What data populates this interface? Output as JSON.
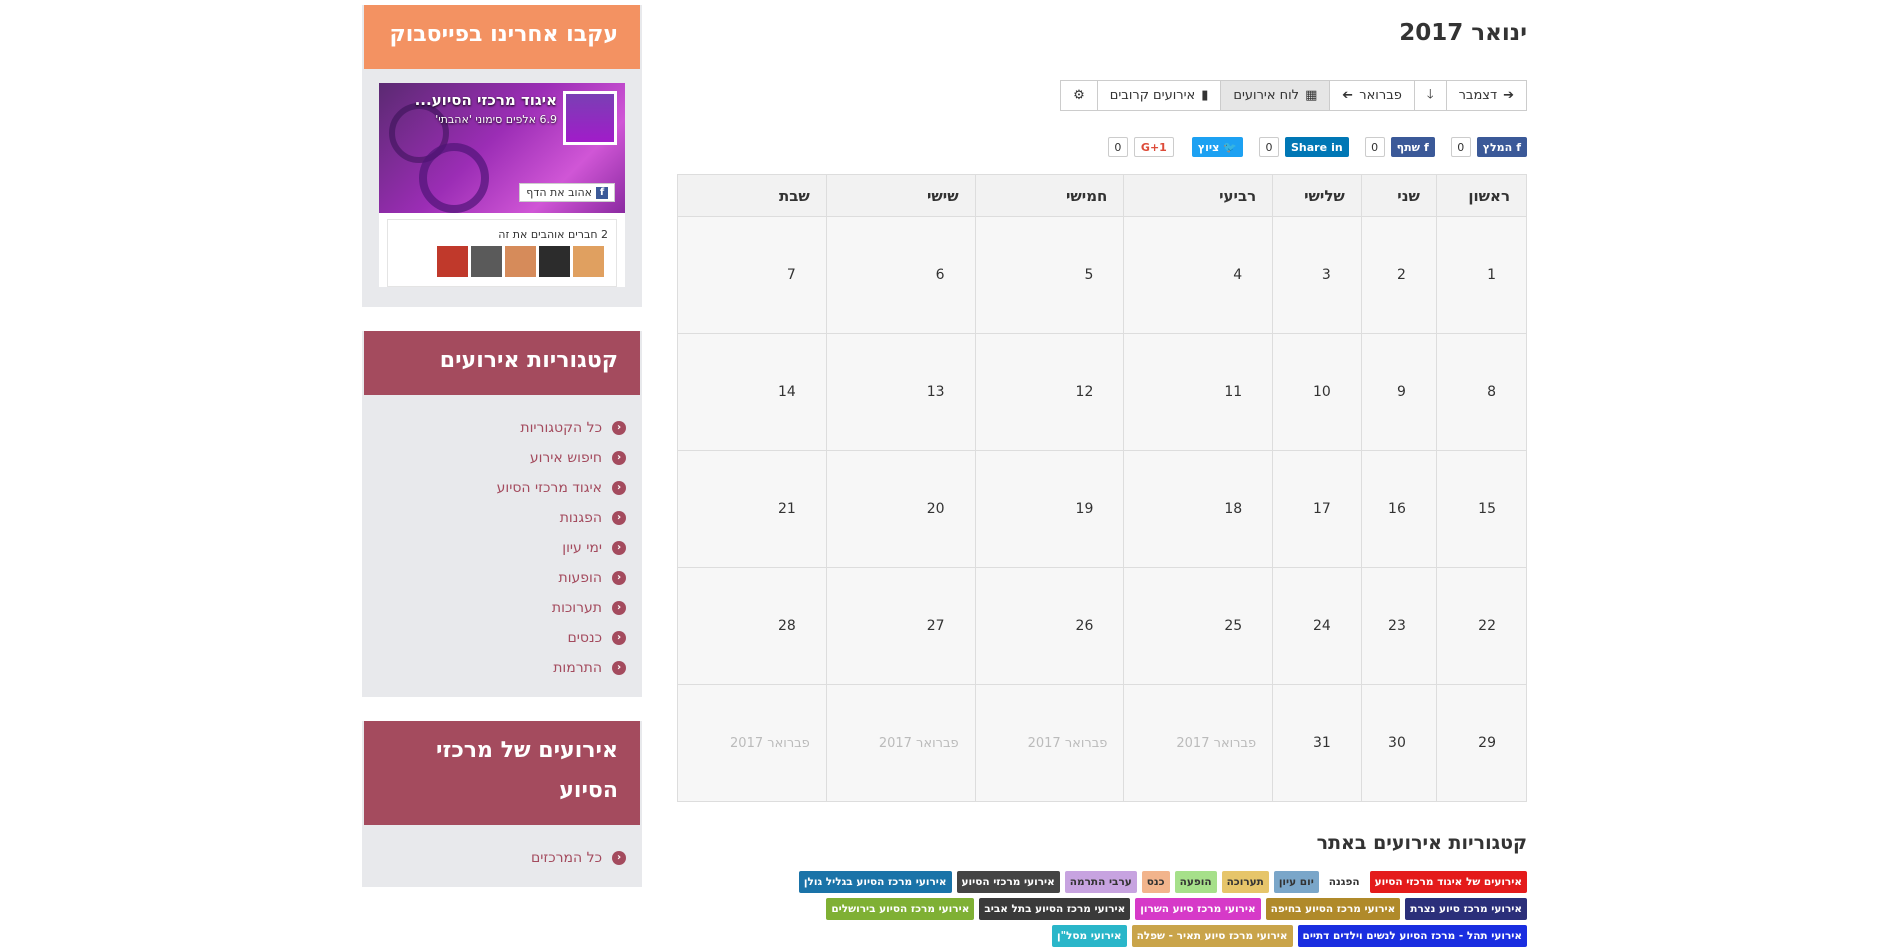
{
  "sidebar": {
    "facebook_widget": {
      "title": "עקבו אחרינו בפייסבוק",
      "page_name": "איגוד מרכזי הסיוע...",
      "likes_text": "6.9 אלפים סימוני 'אהבתי'",
      "like_button": "אהוב את הדף",
      "friends_text": "2 חברים אוהבים את זה",
      "face_colors": [
        "#c0392b",
        "#5a5a5a",
        "#d68b5a",
        "#2c2c2c",
        "#e0a060"
      ]
    },
    "categories_widget": {
      "title": "קטגוריות אירועים",
      "items": [
        {
          "label": "כל הקטגוריות"
        },
        {
          "label": "חיפוש אירוע"
        },
        {
          "label": "איגוד מרכזי הסיוע"
        },
        {
          "label": "הפגנות"
        },
        {
          "label": "ימי עיון"
        },
        {
          "label": "הופעות"
        },
        {
          "label": "תערוכות"
        },
        {
          "label": "כנסים"
        },
        {
          "label": "התרמות"
        }
      ]
    },
    "centers_widget": {
      "title": "אירועים של מרכזי הסיוע",
      "items": [
        {
          "label": "כל המרכזים"
        }
      ]
    }
  },
  "main": {
    "title": "ינואר 2017",
    "toolbar": {
      "prev_month": "דצמבר",
      "down": "",
      "next_month": "פברואר",
      "calendar_view": "לוח אירועים",
      "upcoming": "אירועים קרובים",
      "settings": ""
    },
    "share": {
      "fb_like": "המלץ",
      "fb_like_count": "0",
      "fb_share": "שתף",
      "fb_share_count": "0",
      "linkedin": "Share",
      "linkedin_count": "0",
      "twitter": "ציוץ",
      "twitter_count": "",
      "gplus": "G+1",
      "gplus_count": "0"
    },
    "weekdays": [
      "ראשון",
      "שני",
      "שלישי",
      "רביעי",
      "חמישי",
      "שישי",
      "שבת"
    ],
    "weeks": [
      [
        "1",
        "2",
        "3",
        "4",
        "5",
        "6",
        "7"
      ],
      [
        "8",
        "9",
        "10",
        "11",
        "12",
        "13",
        "14"
      ],
      [
        "15",
        "16",
        "17",
        "18",
        "19",
        "20",
        "21"
      ],
      [
        "22",
        "23",
        "24",
        "25",
        "26",
        "27",
        "28"
      ],
      [
        "29",
        "30",
        "31",
        "פברואר 2017",
        "פברואר 2017",
        "פברואר 2017",
        "פברואר 2017"
      ]
    ],
    "categories_title": "קטגוריות אירועים באתר",
    "tags": [
      [
        {
          "label": "אירועים של איגוד מרכזי הסיוע",
          "color": "#e41b1b"
        },
        {
          "label": "הפגנה",
          "color": "#ffffff",
          "text": "#333333"
        },
        {
          "label": "יום עיון",
          "color": "#7aa6c9",
          "text": "#333333"
        },
        {
          "label": "תערוכה",
          "color": "#e6c56a",
          "text": "#333333"
        },
        {
          "label": "הופעה",
          "color": "#a6e08a",
          "text": "#333333"
        },
        {
          "label": "כנס",
          "color": "#f2b48c",
          "text": "#333333"
        },
        {
          "label": "ערבי התרמה",
          "color": "#c7a3e0",
          "text": "#333333"
        },
        {
          "label": "אירועי מרכזי הסיוע",
          "color": "#444444"
        },
        {
          "label": "אירועי מרכז הסיוע בגליל גולן",
          "color": "#1a73a8"
        }
      ],
      [
        {
          "label": "אירועי מרכז סיוע נצרת",
          "color": "#2b2f7a"
        },
        {
          "label": "אירועי מרכז הסיוע בחיפה",
          "color": "#b08a2a"
        },
        {
          "label": "אירועי מרכז סיוע השרון",
          "color": "#d63ac8"
        },
        {
          "label": "אירועי מרכז הסיוע בתל אביב",
          "color": "#3a3a3a"
        },
        {
          "label": "אירועי מרכז הסיוע בירושלים",
          "color": "#7fb034"
        }
      ],
      [
        {
          "label": "אירועי תהל - מרכז הסיוע לנשים וילדים דתיים",
          "color": "#1a2ee0"
        },
        {
          "label": "אירועי מרכז סיוע תאיר - שפלה",
          "color": "#c9a44a"
        },
        {
          "label": "אירועי מסל\"ן",
          "color": "#2ab6c9"
        }
      ]
    ]
  }
}
